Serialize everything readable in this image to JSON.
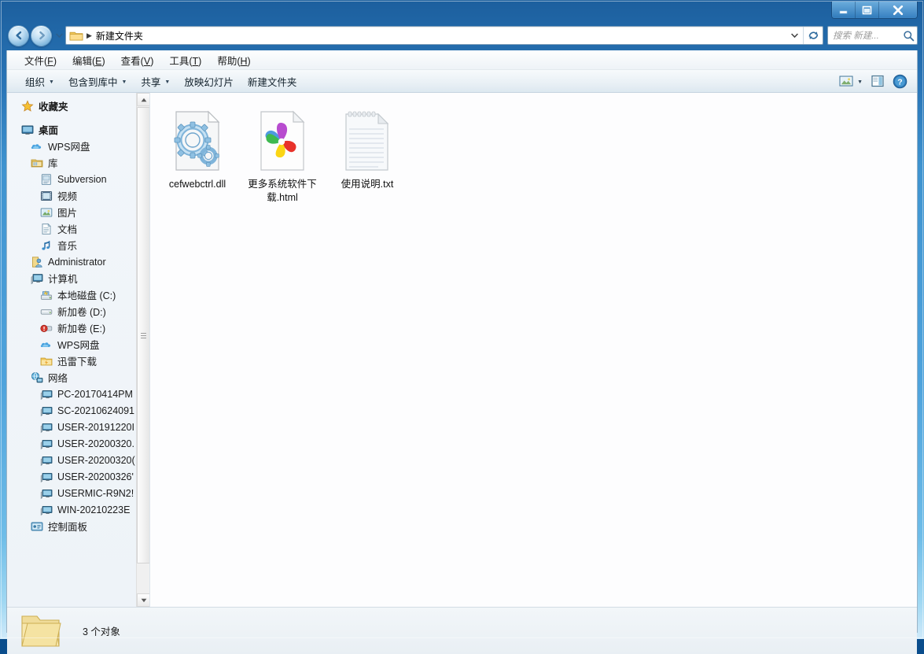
{
  "window": {
    "titlebar": {
      "minimize_label": "最小化",
      "maximize_label": "最大化",
      "close_label": "关闭"
    }
  },
  "addressbar": {
    "back_label": "后退",
    "forward_label": "前进",
    "history_label": "最近浏览的位置",
    "breadcrumb": {
      "separator": "▶",
      "path": "新建文件夹",
      "folder_icon": "folder-icon"
    },
    "dropdown_label": "▼",
    "refresh_label": "刷新",
    "search": {
      "placeholder": "搜索 新建...",
      "icon": "search-icon"
    }
  },
  "menubar": {
    "items": [
      {
        "pre": "文件(",
        "key": "F",
        "post": ")"
      },
      {
        "pre": "编辑(",
        "key": "E",
        "post": ")"
      },
      {
        "pre": "查看(",
        "key": "V",
        "post": ")"
      },
      {
        "pre": "工具(",
        "key": "T",
        "post": ")"
      },
      {
        "pre": "帮助(",
        "key": "H",
        "post": ")"
      }
    ]
  },
  "toolbar": {
    "items": [
      {
        "label": "组织",
        "caret": "▼"
      },
      {
        "label": "包含到库中",
        "caret": "▼"
      },
      {
        "label": "共享",
        "caret": "▼"
      },
      {
        "label": "放映幻灯片",
        "caret": ""
      },
      {
        "label": "新建文件夹",
        "caret": ""
      }
    ],
    "right": {
      "view_icon": "view-mode-icon",
      "view_caret": "▼",
      "preview_pane_icon": "preview-pane-icon",
      "help_icon": "help-icon"
    }
  },
  "navpane": {
    "groups": [
      {
        "items": [
          {
            "label": "收藏夹",
            "icon": "star-icon",
            "level": 0,
            "bold": true
          }
        ]
      },
      {
        "items": [
          {
            "label": "桌面",
            "icon": "desktop-icon",
            "level": 0,
            "bold": true
          },
          {
            "label": "WPS网盘",
            "icon": "cloud-icon",
            "level": 1
          },
          {
            "label": "库",
            "icon": "library-folder-icon",
            "level": 1
          },
          {
            "label": "Subversion",
            "icon": "subversion-icon",
            "level": 2
          },
          {
            "label": "视频",
            "icon": "video-icon",
            "level": 2
          },
          {
            "label": "图片",
            "icon": "pictures-icon",
            "level": 2
          },
          {
            "label": "文档",
            "icon": "documents-icon",
            "level": 2
          },
          {
            "label": "音乐",
            "icon": "music-icon",
            "level": 2
          },
          {
            "label": "Administrator",
            "icon": "user-icon",
            "level": 1
          },
          {
            "label": "计算机",
            "icon": "computer-icon",
            "level": 1
          },
          {
            "label": "本地磁盘 (C:)",
            "icon": "system-drive-icon",
            "level": 2
          },
          {
            "label": "新加卷 (D:)",
            "icon": "drive-icon",
            "level": 2
          },
          {
            "label": "新加卷 (E:)",
            "icon": "drive-warning-icon",
            "level": 2
          },
          {
            "label": "WPS网盘",
            "icon": "cloud-icon",
            "level": 2
          },
          {
            "label": "迅雷下载",
            "icon": "thunder-folder-icon",
            "level": 2
          },
          {
            "label": "网络",
            "icon": "network-icon",
            "level": 1
          },
          {
            "label": "PC-20170414PM",
            "icon": "computer-node-icon",
            "level": 2
          },
          {
            "label": "SC-20210624091",
            "icon": "computer-node-icon",
            "level": 2
          },
          {
            "label": "USER-20191220I",
            "icon": "computer-node-icon",
            "level": 2
          },
          {
            "label": "USER-20200320.",
            "icon": "computer-node-icon",
            "level": 2
          },
          {
            "label": "USER-20200320(",
            "icon": "computer-node-icon",
            "level": 2
          },
          {
            "label": "USER-20200326'",
            "icon": "computer-node-icon",
            "level": 2
          },
          {
            "label": "USERMIC-R9N2!",
            "icon": "computer-node-icon",
            "level": 2
          },
          {
            "label": "WIN-20210223E",
            "icon": "computer-node-icon",
            "level": 2
          },
          {
            "label": "控制面板",
            "icon": "control-panel-icon",
            "level": 1
          }
        ]
      }
    ],
    "scrollbar": {
      "up_label": "▲",
      "down_label": "▼"
    }
  },
  "content": {
    "files": [
      {
        "name": "cefwebctrl.dll",
        "icon": "dll-gears-icon"
      },
      {
        "name": "更多系统软件下载.html",
        "icon": "html-pinwheel-icon"
      },
      {
        "name": "使用说明.txt",
        "icon": "text-file-icon"
      }
    ]
  },
  "statusbar": {
    "folder_icon": "folder-open-icon",
    "text": "3 个对象"
  },
  "colors": {
    "frame_blue": "#3f93cf",
    "content_bg": "#fdfdfe",
    "navpane_bg": "#f2f6fa",
    "toolbar_bg": "#eaf1f6",
    "accent_blue": "#2f6b9e"
  }
}
